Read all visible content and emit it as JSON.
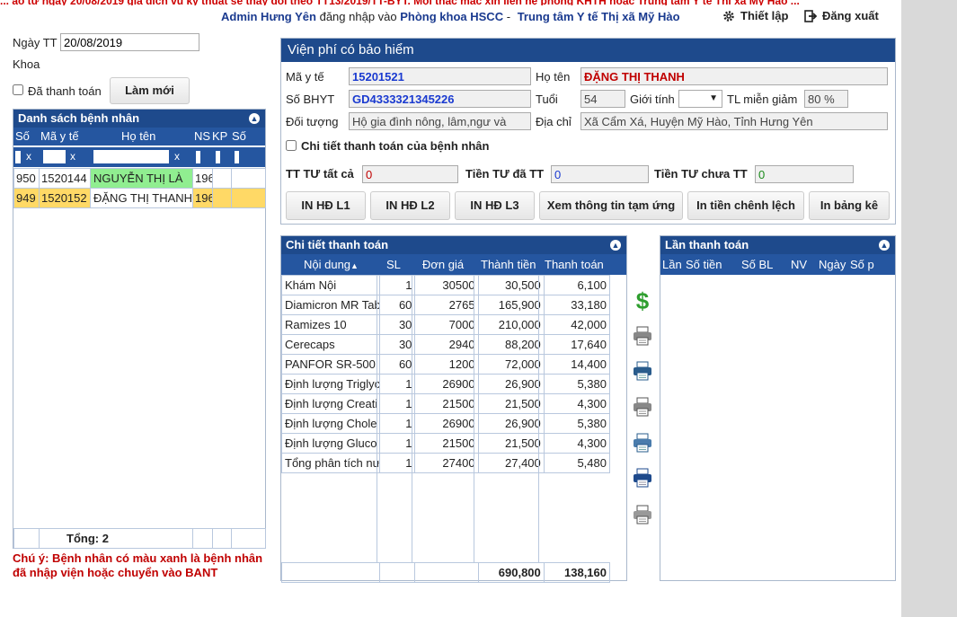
{
  "header": {
    "marquee": "... áo từ ngày 20/08/2019 giá dịch vụ kỹ thuật sẽ thay đổi theo TT13/2019/TT-BYT. Mọi thắc mắc xin liên hệ phòng KHTH hoặc Trung tâm Y tế Thị xã Mỹ Hào ...",
    "user": "Admin Hưng Yên",
    "login_text": "đăng nhập vào",
    "department": "Phòng khoa HSCC",
    "separator": "-",
    "center": "Trung tâm Y tế Thị xã Mỹ Hào",
    "settings_label": "Thiết lập",
    "logout_label": "Đăng xuất"
  },
  "left": {
    "date_label": "Ngày TT",
    "date_value": "20/08/2019",
    "dept_label": "Khoa",
    "paid_label": "Đã thanh toán",
    "refresh_label": "Làm mới",
    "list_title": "Danh sách bệnh nhân",
    "columns": [
      "Số",
      "Mã y tế",
      "Họ tên",
      "NS",
      "KP",
      "Số"
    ],
    "filter_x": "x",
    "rows": [
      {
        "so": "950",
        "ma": "1520144",
        "ten": "NGUYỄN THỊ LÀ",
        "ns": "196"
      },
      {
        "so": "949",
        "ma": "1520152",
        "ten": "ĐẶNG THỊ THANH",
        "ns": "196"
      }
    ],
    "total_label": "Tổng: 2",
    "note": "Chú ý: Bệnh nhân có màu xanh là bệnh nhân đã nhập viện hoặc chuyển vào BANT"
  },
  "form": {
    "title": "Viện phí có bảo hiểm",
    "ma_yte_label": "Mã y tế",
    "ma_yte": "15201521",
    "ho_ten_label": "Họ tên",
    "ho_ten": "ĐẶNG THỊ THANH",
    "bhyt_label": "Số BHYT",
    "bhyt": "GD4333321345226",
    "tuoi_label": "Tuổi",
    "tuoi": "54",
    "gioi_tinh_label": "Giới tính",
    "tl_label": "TL miễn giảm",
    "tl": "80 %",
    "doi_tuong_label": "Đối tượng",
    "doi_tuong": "Hộ gia đình nông, lâm,ngư và",
    "dia_chi_label": "Địa chỉ",
    "dia_chi": "Xã Cẩm Xá, Huyện Mỹ Hào, Tỉnh Hưng Yên",
    "chi_tiet_label": "Chi tiết thanh toán của bệnh nhân",
    "tt_tat_ca_label": "TT TƯ tất cả",
    "tt_tat_ca": "0",
    "da_tt_label": "Tiền TƯ đã TT",
    "da_tt": "0",
    "chua_tt_label": "Tiền TƯ chưa TT",
    "chua_tt": "0",
    "buttons": [
      "IN HĐ L1",
      "IN HĐ L2",
      "IN HĐ L3",
      "Xem thông tin tạm ứng",
      "In tiền chênh lệch",
      "In bảng kê"
    ]
  },
  "detail": {
    "title": "Chi tiết thanh toán",
    "columns": [
      "Nội dung",
      "SL",
      "Đơn giá",
      "Thành tiền",
      "Thanh toán"
    ],
    "sort_arrow": "▲",
    "rows": [
      {
        "nd": "Khám Nội",
        "sl": "1",
        "dg": "30500",
        "tt": "30,500",
        "thanh": "6,100"
      },
      {
        "nd": "Diamicron MR Tab",
        "sl": "60",
        "dg": "2765",
        "tt": "165,900",
        "thanh": "33,180"
      },
      {
        "nd": "Ramizes 10",
        "sl": "30",
        "dg": "7000",
        "tt": "210,000",
        "thanh": "42,000"
      },
      {
        "nd": "Cerecaps",
        "sl": "30",
        "dg": "2940",
        "tt": "88,200",
        "thanh": "17,640"
      },
      {
        "nd": "PANFOR SR-500",
        "sl": "60",
        "dg": "1200",
        "tt": "72,000",
        "thanh": "14,400"
      },
      {
        "nd": "Định lượng Triglyc",
        "sl": "1",
        "dg": "26900",
        "tt": "26,900",
        "thanh": "5,380"
      },
      {
        "nd": "Định lượng Creati",
        "sl": "1",
        "dg": "21500",
        "tt": "21,500",
        "thanh": "4,300"
      },
      {
        "nd": "Định lượng Chole",
        "sl": "1",
        "dg": "26900",
        "tt": "26,900",
        "thanh": "5,380"
      },
      {
        "nd": "Định lượng Gluco",
        "sl": "1",
        "dg": "21500",
        "tt": "21,500",
        "thanh": "4,300"
      },
      {
        "nd": "Tổng phân tích nư",
        "sl": "1",
        "dg": "27400",
        "tt": "27,400",
        "thanh": "5,480"
      }
    ],
    "total_tt": "690,800",
    "total_thanh": "138,160"
  },
  "history": {
    "title": "Lần thanh toán",
    "columns": [
      "Lần",
      "Số tiền",
      "Số BL",
      "NV",
      "Ngày",
      "Số p"
    ]
  },
  "colors": {
    "header_blue": "#1e4a8c",
    "green_row": "#90ee90",
    "yellow_row": "#ffd966",
    "red_text": "#c00000"
  }
}
